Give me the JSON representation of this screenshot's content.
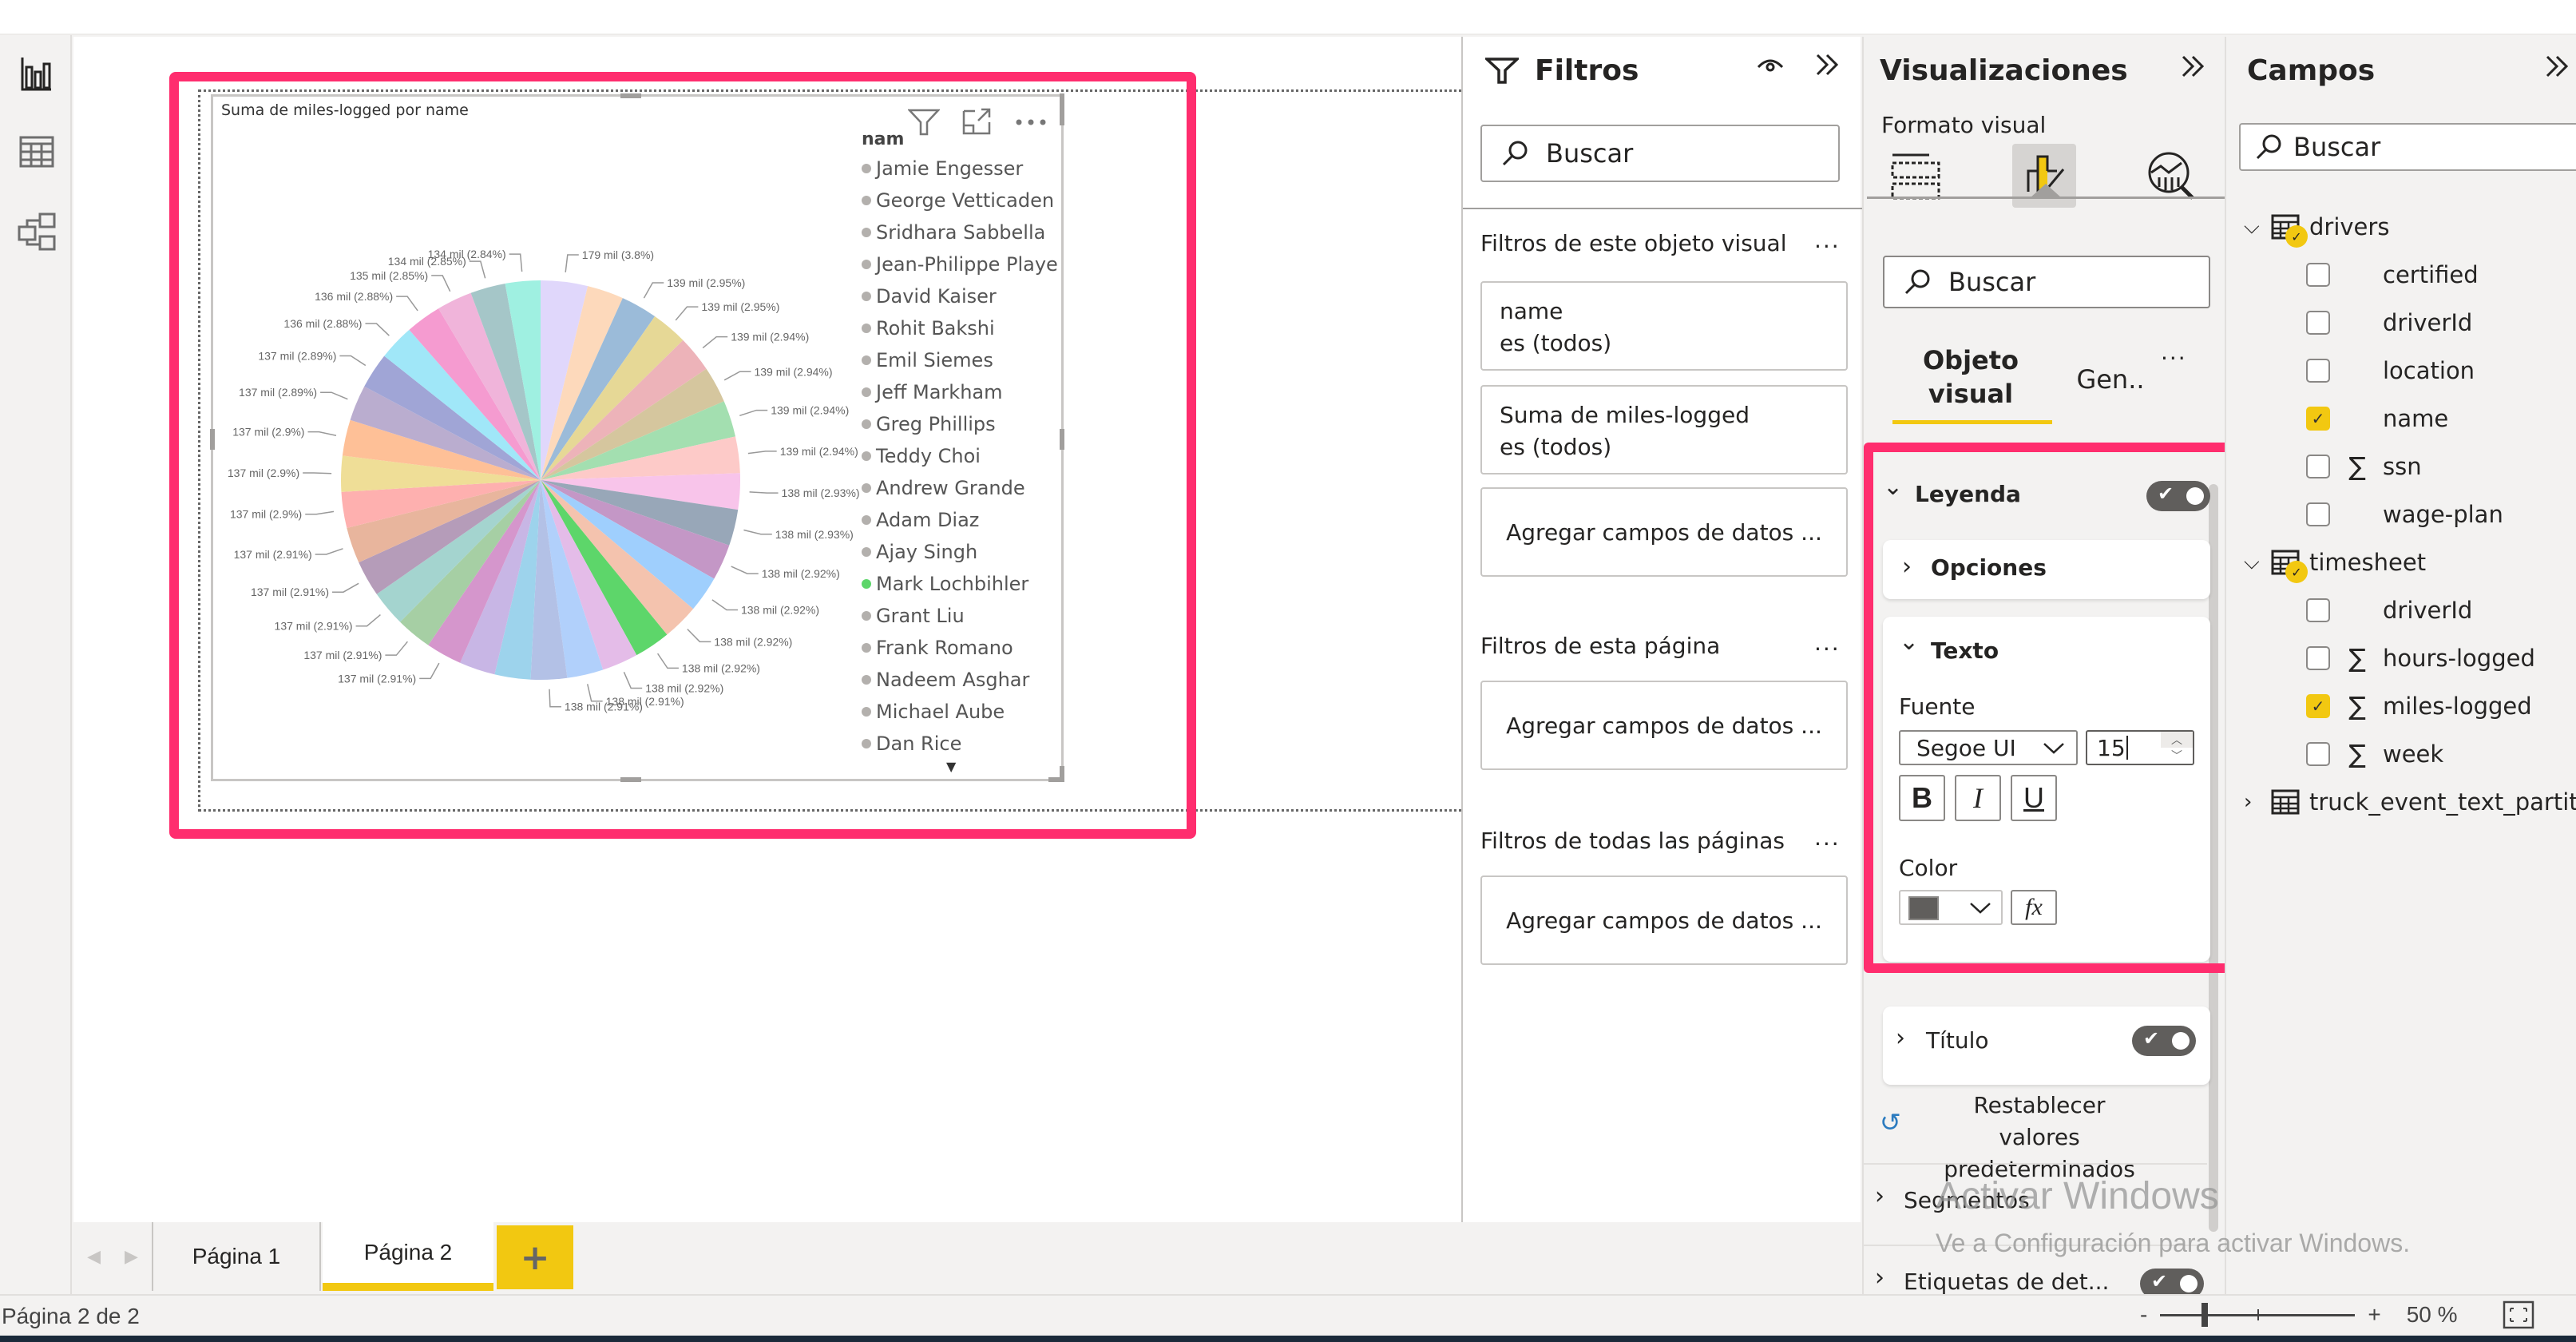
{
  "nav_rail": {
    "items": [
      {
        "name": "report-view",
        "icon": "bar-chart-icon"
      },
      {
        "name": "data-view",
        "icon": "table-icon"
      },
      {
        "name": "model-view",
        "icon": "model-icon"
      }
    ]
  },
  "visual": {
    "title": "Suma de miles-logged por name",
    "legend_header": "nam",
    "legend_items": [
      {
        "label": "Jamie Engesser",
        "color": "#b3b0ad"
      },
      {
        "label": "George Vetticaden",
        "color": "#b3b0ad"
      },
      {
        "label": "Sridhara Sabbella",
        "color": "#b3b0ad"
      },
      {
        "label": "Jean-Philippe Playe",
        "color": "#b3b0ad"
      },
      {
        "label": "David Kaiser",
        "color": "#b3b0ad"
      },
      {
        "label": "Rohit Bakshi",
        "color": "#b3b0ad"
      },
      {
        "label": "Emil Siemes",
        "color": "#b3b0ad"
      },
      {
        "label": "Jeff Markham",
        "color": "#b3b0ad"
      },
      {
        "label": "Greg Phillips",
        "color": "#b3b0ad"
      },
      {
        "label": "Teddy Choi",
        "color": "#b3b0ad"
      },
      {
        "label": "Andrew Grande",
        "color": "#b3b0ad"
      },
      {
        "label": "Adam Diaz",
        "color": "#b3b0ad"
      },
      {
        "label": "Ajay Singh",
        "color": "#b3b0ad"
      },
      {
        "label": "Mark Lochbihler",
        "color": "#5dd66a"
      },
      {
        "label": "Grant Liu",
        "color": "#b3b0ad"
      },
      {
        "label": "Frank Romano",
        "color": "#b3b0ad"
      },
      {
        "label": "Nadeem Asghar",
        "color": "#b3b0ad"
      },
      {
        "label": "Michael Aube",
        "color": "#b3b0ad"
      },
      {
        "label": "Dan Rice",
        "color": "#b3b0ad"
      }
    ],
    "header_icons": [
      "filter-icon",
      "focus-mode-icon",
      "more-options-icon"
    ]
  },
  "chart_data": {
    "type": "pie",
    "title": "Suma de miles-logged por name",
    "unit_label": "mil",
    "legend_title": "name",
    "legend_placement": "right",
    "slices": [
      {
        "value": 179,
        "pct": 3.8,
        "label": "179 mil (3.8%)",
        "color": "#e0d7fb"
      },
      {
        "value": 139,
        "pct": 2.95,
        "label": "",
        "color": "#fdd9bb"
      },
      {
        "value": 139,
        "pct": 2.95,
        "label": "139 mil (2.95%)",
        "color": "#9bbbd9"
      },
      {
        "value": 139,
        "pct": 2.95,
        "label": "139 mil (2.95%)",
        "color": "#e6d896"
      },
      {
        "value": 139,
        "pct": 2.94,
        "label": "139 mil (2.94%)",
        "color": "#edb3b9"
      },
      {
        "value": 139,
        "pct": 2.94,
        "label": "139 mil (2.94%)",
        "color": "#d5c69e"
      },
      {
        "value": 139,
        "pct": 2.94,
        "label": "139 mil (2.94%)",
        "color": "#a3dfb0"
      },
      {
        "value": 139,
        "pct": 2.94,
        "label": "139 mil (2.94%)",
        "color": "#fdcac8"
      },
      {
        "value": 138,
        "pct": 2.93,
        "label": "138 mil (2.93%)",
        "color": "#f8c4ea"
      },
      {
        "value": 138,
        "pct": 2.93,
        "label": "138 mil (2.93%)",
        "color": "#98a7b8"
      },
      {
        "value": 138,
        "pct": 2.92,
        "label": "138 mil (2.92%)",
        "color": "#c497c6"
      },
      {
        "value": 138,
        "pct": 2.92,
        "label": "138 mil (2.92%)",
        "color": "#9fcffd"
      },
      {
        "value": 138,
        "pct": 2.92,
        "label": "138 mil (2.92%)",
        "color": "#f4c3ae"
      },
      {
        "value": 138,
        "pct": 2.92,
        "label": "138 mil (2.92%)",
        "color": "#5dd66a"
      },
      {
        "value": 138,
        "pct": 2.92,
        "label": "138 mil (2.92%)",
        "color": "#e4bce8"
      },
      {
        "value": 138,
        "pct": 2.91,
        "label": "138 mil (2.91%)",
        "color": "#b1d0fb"
      },
      {
        "value": 138,
        "pct": 2.91,
        "label": "138 mil (2.91%)",
        "color": "#b3c1e6"
      },
      {
        "value": 137,
        "pct": 2.91,
        "label": "",
        "color": "#9dd3ec"
      },
      {
        "value": 137,
        "pct": 2.91,
        "label": "",
        "color": "#c8b6e5"
      },
      {
        "value": 137,
        "pct": 2.91,
        "label": "137 mil (2.91%)",
        "color": "#d596cc"
      },
      {
        "value": 137,
        "pct": 2.91,
        "label": "137 mil (2.91%)",
        "color": "#a6cfa4"
      },
      {
        "value": 137,
        "pct": 2.91,
        "label": "137 mil (2.91%)",
        "color": "#a4d4cf"
      },
      {
        "value": 137,
        "pct": 2.91,
        "label": "137 mil (2.91%)",
        "color": "#b59cb9"
      },
      {
        "value": 137,
        "pct": 2.91,
        "label": "137 mil (2.91%)",
        "color": "#e8b59d"
      },
      {
        "value": 137,
        "pct": 2.9,
        "label": "137 mil (2.9%)",
        "color": "#feb0af"
      },
      {
        "value": 137,
        "pct": 2.9,
        "label": "137 mil (2.9%)",
        "color": "#efde97"
      },
      {
        "value": 137,
        "pct": 2.9,
        "label": "137 mil (2.9%)",
        "color": "#fec097"
      },
      {
        "value": 137,
        "pct": 2.89,
        "label": "137 mil (2.89%)",
        "color": "#baadcf"
      },
      {
        "value": 137,
        "pct": 2.89,
        "label": "137 mil (2.89%)",
        "color": "#a0a5d6"
      },
      {
        "value": 136,
        "pct": 2.88,
        "label": "136 mil (2.88%)",
        "color": "#a0e7f8"
      },
      {
        "value": 136,
        "pct": 2.88,
        "label": "136 mil (2.88%)",
        "color": "#f59bd0"
      },
      {
        "value": 135,
        "pct": 2.85,
        "label": "135 mil (2.85%)",
        "color": "#f0b4da"
      },
      {
        "value": 134,
        "pct": 2.85,
        "label": "134 mil (2.85%)",
        "color": "#a5c6c8"
      },
      {
        "value": 134,
        "pct": 2.84,
        "label": "134 mil (2.84%)",
        "color": "#9ff0e1"
      }
    ]
  },
  "page_tabs": {
    "tabs": [
      {
        "label": "Página 1",
        "active": false
      },
      {
        "label": "Página 2",
        "active": true
      }
    ],
    "add_label": "+"
  },
  "status_bar": {
    "page_text": "Página 2 de 2",
    "zoom_minus": "-",
    "zoom_plus": "+",
    "zoom_level": "50 %",
    "zoom_value_percent": 50
  },
  "filters_pane": {
    "title": "Filtros",
    "search_placeholder": "Buscar",
    "visual_section": "Filtros de este objeto visual",
    "visual_filters": [
      {
        "field": "name",
        "condition": "es (todos)"
      },
      {
        "field": "Suma de miles-logged",
        "condition": "es (todos)"
      }
    ],
    "add_fields_label": "Agregar campos de datos ...",
    "page_section": "Filtros de esta página",
    "all_pages_section": "Filtros de todas las páginas",
    "more": "..."
  },
  "viz_pane": {
    "title": "Visualizaciones",
    "format_label": "Formato visual",
    "search_placeholder": "Buscar",
    "subtabs": [
      "Objeto visual",
      "Gen.."
    ],
    "more": "...",
    "leyenda": {
      "label": "Leyenda",
      "enabled": true,
      "opciones_label": "Opciones",
      "texto_label": "Texto",
      "fuente_label": "Fuente",
      "font_family": "Segoe UI",
      "font_size": "15",
      "bold_label": "B",
      "italic_label": "I",
      "underline_label": "U",
      "color_label": "Color",
      "color_value": "#605e5c",
      "fx_label": "fx"
    },
    "titulo": {
      "label": "Título",
      "enabled": true
    },
    "reset_label": "Restablecer valores predeterminados",
    "segmentos_label": "Segmentos",
    "etiquetas_label": "Etiquetas de det...",
    "etiquetas_enabled": true
  },
  "watermark": {
    "line1": "Activar Windows",
    "line2": "Ve a Configuración para activar Windows."
  },
  "fields_pane": {
    "title": "Campos",
    "search_placeholder": "Buscar",
    "tables": [
      {
        "name": "drivers",
        "expanded": true,
        "has_selection": true,
        "fields": [
          {
            "name": "certified",
            "checked": false,
            "sigma": false
          },
          {
            "name": "driverId",
            "checked": false,
            "sigma": false
          },
          {
            "name": "location",
            "checked": false,
            "sigma": false
          },
          {
            "name": "name",
            "checked": true,
            "sigma": false
          },
          {
            "name": "ssn",
            "checked": false,
            "sigma": true
          },
          {
            "name": "wage-plan",
            "checked": false,
            "sigma": false
          }
        ]
      },
      {
        "name": "timesheet",
        "expanded": true,
        "has_selection": true,
        "fields": [
          {
            "name": "driverId",
            "checked": false,
            "sigma": false
          },
          {
            "name": "hours-logged",
            "checked": false,
            "sigma": true
          },
          {
            "name": "miles-logged",
            "checked": true,
            "sigma": true
          },
          {
            "name": "week",
            "checked": false,
            "sigma": true
          }
        ]
      },
      {
        "name": "truck_event_text_partiti...",
        "expanded": false,
        "has_selection": false,
        "fields": []
      }
    ]
  },
  "accent_colors": {
    "yellow": "#f2c811",
    "highlight": "#ff2d6e"
  }
}
